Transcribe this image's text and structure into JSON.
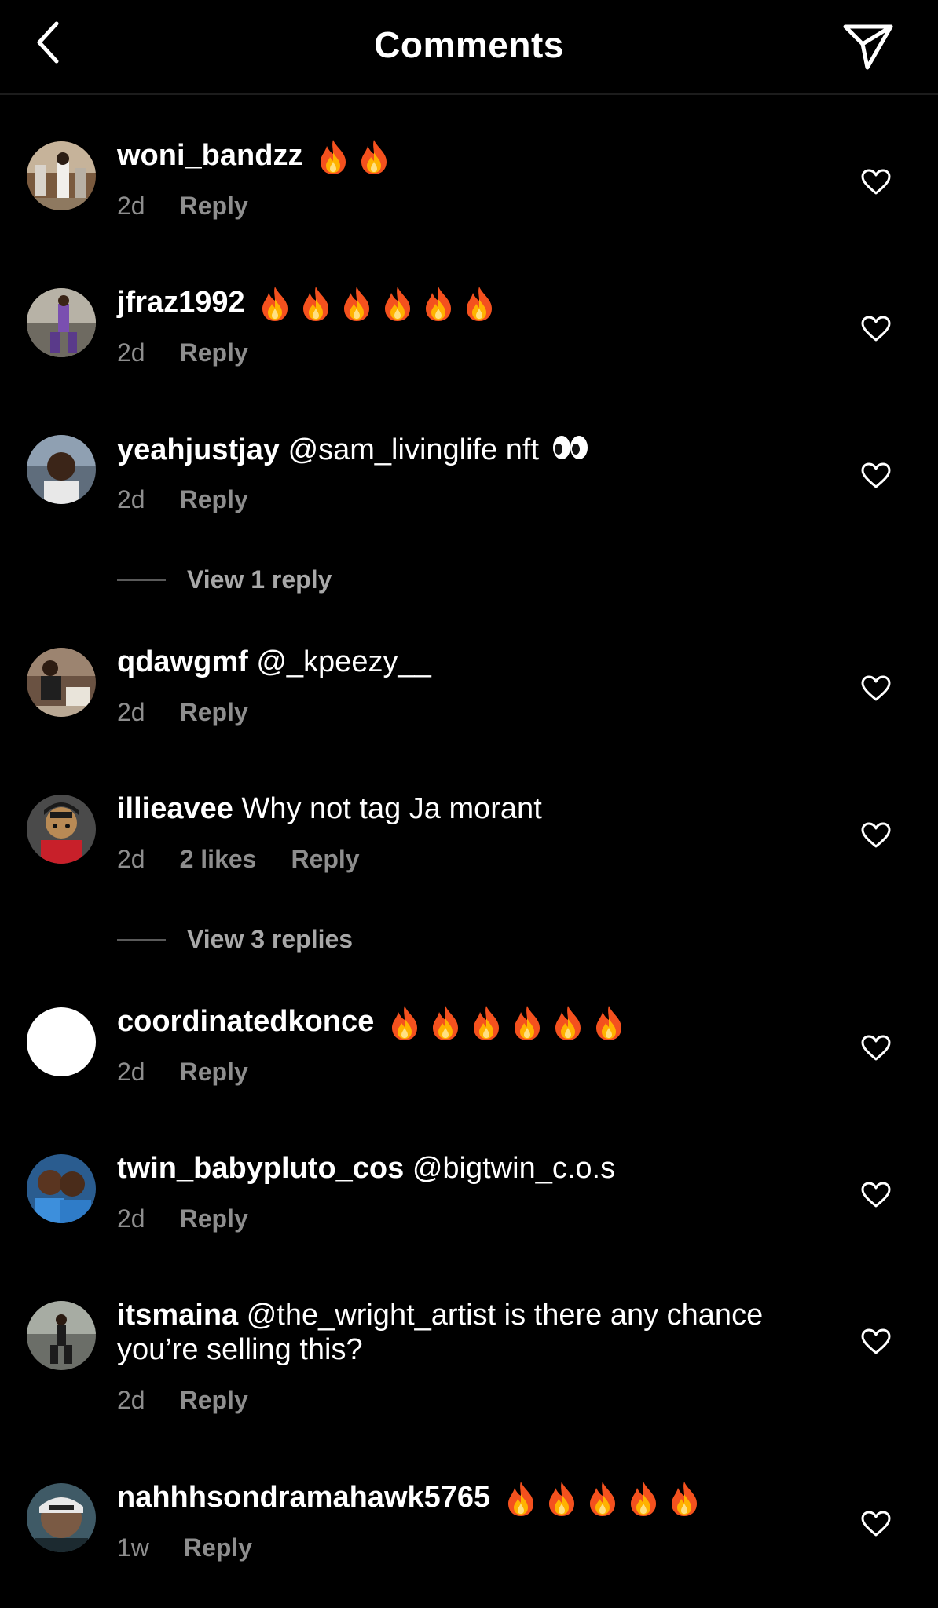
{
  "header": {
    "title": "Comments",
    "back_icon": "chevron-left-icon",
    "share_icon": "paper-plane-icon"
  },
  "colors": {
    "background": "#000000",
    "text_primary": "#ffffff",
    "text_secondary": "#8e8e8e"
  },
  "comments": [
    {
      "username": "woni_bandzz",
      "text": "",
      "fire_count": 2,
      "time": "2d",
      "likes": "",
      "reply_label": "Reply",
      "avatar": "photo"
    },
    {
      "username": "jfraz1992",
      "text": "",
      "fire_count": 6,
      "time": "2d",
      "likes": "",
      "reply_label": "Reply",
      "avatar": "photo"
    },
    {
      "username": "yeahjustjay",
      "text": "@sam_livinglife nft",
      "eyes_emoji": true,
      "time": "2d",
      "likes": "",
      "reply_label": "Reply",
      "view_replies": "View 1 reply",
      "avatar": "photo"
    },
    {
      "username": "qdawgmf",
      "text": "@_kpeezy__",
      "time": "2d",
      "likes": "",
      "reply_label": "Reply",
      "avatar": "photo"
    },
    {
      "username": "illieavee",
      "text": "Why not tag Ja morant",
      "time": "2d",
      "likes": "2 likes",
      "reply_label": "Reply",
      "view_replies": "View 3 replies",
      "avatar": "illustration"
    },
    {
      "username": "coordinatedkonce",
      "text": "",
      "fire_count": 6,
      "time": "2d",
      "likes": "",
      "reply_label": "Reply",
      "avatar": "blank-white"
    },
    {
      "username": "twin_babypluto_cos",
      "text": "@bigtwin_c.o.s",
      "time": "2d",
      "likes": "",
      "reply_label": "Reply",
      "avatar": "photo"
    },
    {
      "username": "itsmaina",
      "text": "@the_wright_artist is there any chance you’re selling this?",
      "time": "2d",
      "likes": "",
      "reply_label": "Reply",
      "avatar": "photo"
    },
    {
      "username": "nahhhsondramahawk5765",
      "text": "",
      "fire_count": 5,
      "time": "1w",
      "likes": "",
      "reply_label": "Reply",
      "avatar": "photo"
    }
  ]
}
